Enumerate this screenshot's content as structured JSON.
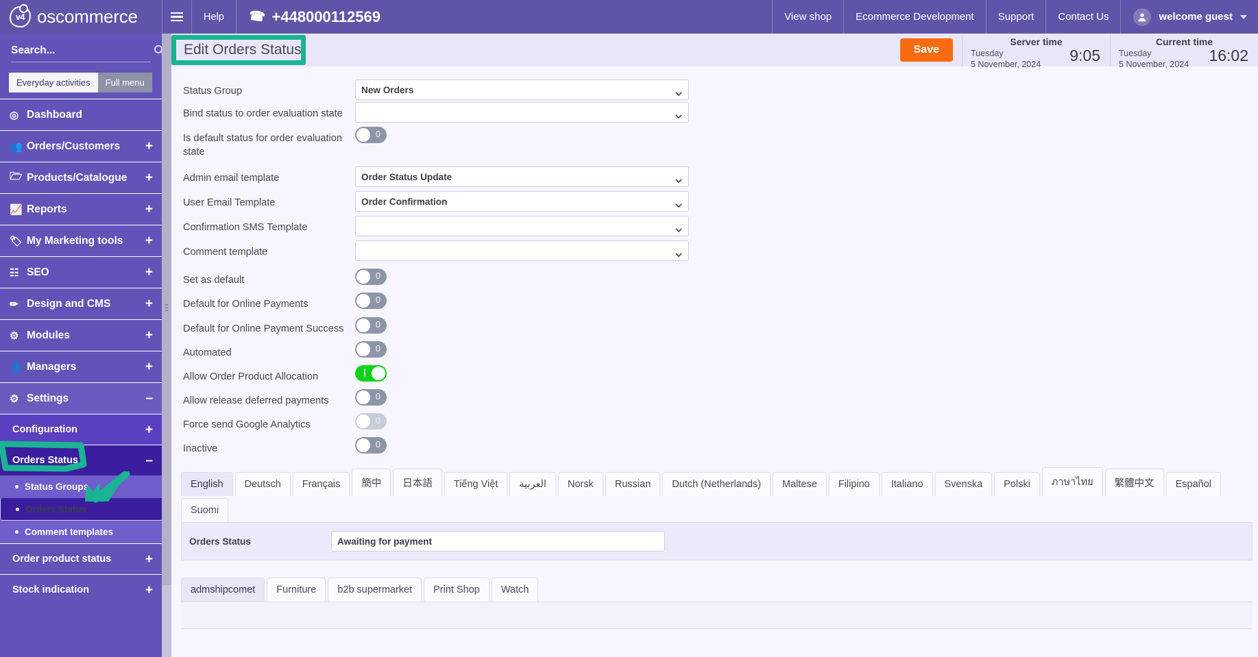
{
  "colors": {
    "brand_purple": "#5f55a8",
    "sidebar_purple": "#6253b8",
    "accent_teal": "#1ab394",
    "save_orange": "#f96b11",
    "toggle_on_green": "#0fd31a",
    "selected_nav": "#3b1e9e"
  },
  "topbar": {
    "brand_logo_text": "v4",
    "brand_name": "oscommerce",
    "menu_icon": "hamburger-icon",
    "help_label": "Help",
    "phone_icon": "phone-icon",
    "phone": "+448000112569",
    "nav": [
      {
        "label": "View shop"
      },
      {
        "label": "Ecommerce Development"
      },
      {
        "label": "Support"
      },
      {
        "label": "Contact Us"
      }
    ],
    "user": {
      "avatar_icon": "user-icon",
      "label": "welcome guest",
      "caret_icon": "caret-down-icon"
    }
  },
  "sidebar": {
    "search": {
      "placeholder": "Search...",
      "value": "",
      "icon": "search-icon"
    },
    "segments": [
      {
        "label": "Everyday activities",
        "active": true
      },
      {
        "label": "Full menu",
        "active": false
      }
    ],
    "items": [
      {
        "label": "Dashboard",
        "icon": "dashboard-icon",
        "expander": ""
      },
      {
        "label": "Orders/Customers",
        "icon": "users-icon",
        "expander": "+"
      },
      {
        "label": "Products/Catalogue",
        "icon": "folder-icon",
        "expander": "+"
      },
      {
        "label": "Reports",
        "icon": "chart-line-icon",
        "expander": "+"
      },
      {
        "label": "My Marketing tools",
        "icon": "tags-icon",
        "expander": "+"
      },
      {
        "label": "SEO",
        "icon": "sitemap-icon",
        "expander": "+"
      },
      {
        "label": "Design and CMS",
        "icon": "paintbrush-icon",
        "expander": "+"
      },
      {
        "label": "Modules",
        "icon": "puzzle-icon",
        "expander": "+"
      },
      {
        "label": "Managers",
        "icon": "user-icon",
        "expander": "+"
      },
      {
        "label": "Settings",
        "icon": "gears-icon",
        "expander": "–",
        "highlighted": true
      }
    ],
    "settings_children": [
      {
        "label": "Configuration",
        "expander": "+"
      },
      {
        "label": "Orders Status",
        "expander": "–",
        "current": true
      }
    ],
    "orders_status_children": [
      {
        "label": "Status Groups",
        "selected": false
      },
      {
        "label": "Orders Status",
        "selected": true
      },
      {
        "label": "Comment templates",
        "selected": false
      }
    ],
    "items_after": [
      {
        "label": "Order product status",
        "expander": "+"
      },
      {
        "label": "Stock indication",
        "expander": "+"
      }
    ]
  },
  "header": {
    "title": "Edit Orders Status",
    "save_label": "Save",
    "server_time": {
      "title": "Server time",
      "day": "Tuesday",
      "date": "5 November, 2024",
      "time": "9:05"
    },
    "current_time": {
      "title": "Current time",
      "day": "Tuesday",
      "date": "5 November, 2024",
      "time": "16:02"
    }
  },
  "form": {
    "rows": [
      {
        "label": "Status Group",
        "type": "select",
        "value": "New Orders"
      },
      {
        "label": "Bind status to order evaluation state",
        "type": "select",
        "value": ""
      },
      {
        "label": "Is default status for order evaluation state",
        "type": "toggle",
        "value": "0",
        "on": false
      },
      {
        "label": "Admin email template",
        "type": "select",
        "value": "Order Status Update"
      },
      {
        "label": "User Email Template",
        "type": "select",
        "value": "Order Confirmation"
      },
      {
        "label": "Confirmation SMS Template",
        "type": "select",
        "value": ""
      },
      {
        "label": "Comment template",
        "type": "select",
        "value": ""
      },
      {
        "label": "Set as default",
        "type": "toggle",
        "value": "0",
        "on": false
      },
      {
        "label": "Default for Online Payments",
        "type": "toggle",
        "value": "0",
        "on": false
      },
      {
        "label": "Default for Online Payment Success",
        "type": "toggle",
        "value": "0",
        "on": false
      },
      {
        "label": "Automated",
        "type": "toggle",
        "value": "0",
        "on": false
      },
      {
        "label": "Allow Order Product Allocation",
        "type": "toggle",
        "value": "",
        "on": true
      },
      {
        "label": "Allow release deferred payments",
        "type": "toggle",
        "value": "0",
        "on": false
      },
      {
        "label": "Force send Google Analytics",
        "type": "toggle",
        "value": "0",
        "on": false,
        "disabled": true
      },
      {
        "label": "Inactive",
        "type": "toggle",
        "value": "0",
        "on": false
      }
    ]
  },
  "language_tabs": [
    {
      "label": "English",
      "active": true
    },
    {
      "label": "Deutsch",
      "active": false
    },
    {
      "label": "Français",
      "active": false
    },
    {
      "label": "簡中",
      "active": false
    },
    {
      "label": "日本語",
      "active": false
    },
    {
      "label": "Tiếng Việt",
      "active": false
    },
    {
      "label": "العربية",
      "active": false
    },
    {
      "label": "Norsk",
      "active": false
    },
    {
      "label": "Russian",
      "active": false
    },
    {
      "label": "Dutch (Netherlands)",
      "active": false
    },
    {
      "label": "Maltese",
      "active": false
    },
    {
      "label": "Filipino",
      "active": false
    },
    {
      "label": "Italiano",
      "active": false
    },
    {
      "label": "Svenska",
      "active": false
    },
    {
      "label": "Polski",
      "active": false
    },
    {
      "label": "ภาษาไทย",
      "active": false
    },
    {
      "label": "繁體中文",
      "active": false
    },
    {
      "label": "Español",
      "active": false
    },
    {
      "label": "Suomi",
      "active": false
    }
  ],
  "language_panel": {
    "label": "Orders Status",
    "value": "Awaiting for payment"
  },
  "store_tabs": [
    {
      "label": "admshipcomet",
      "active": true
    },
    {
      "label": "Furniture",
      "active": false
    },
    {
      "label": "b2b supermarket",
      "active": false
    },
    {
      "label": "Print Shop",
      "active": false
    },
    {
      "label": "Watch",
      "active": false
    }
  ]
}
